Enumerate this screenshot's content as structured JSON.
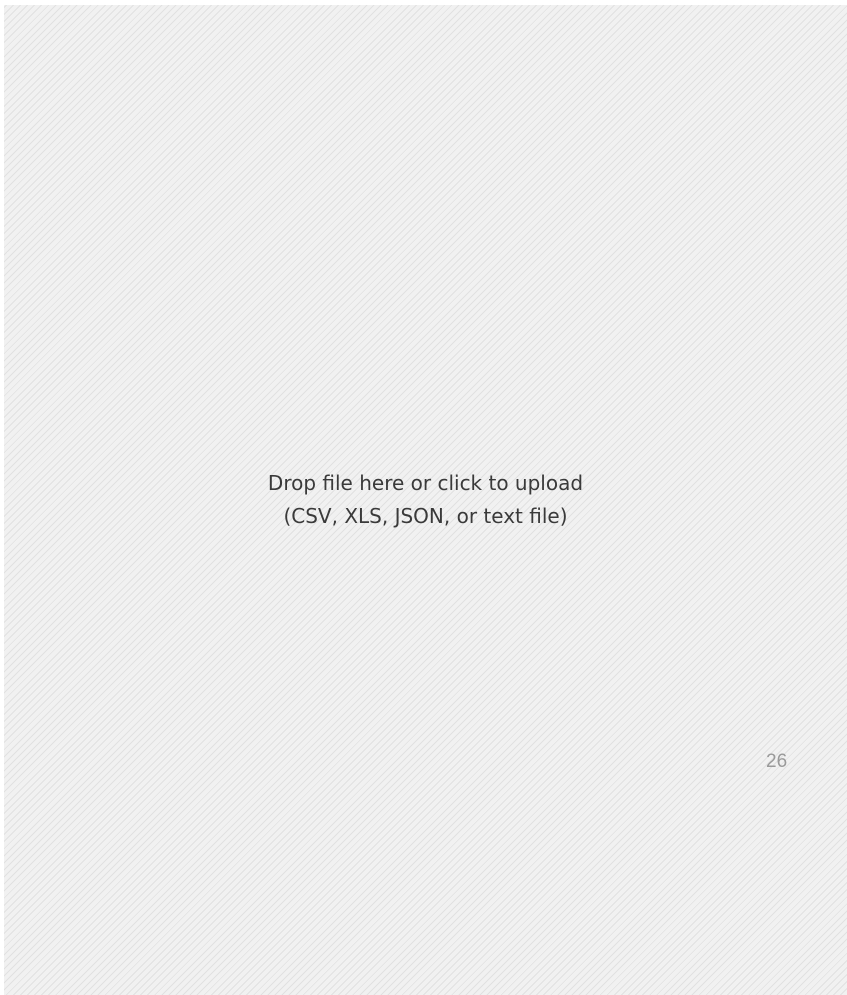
{
  "dropzone": {
    "line1": "Drop file here or click to upload",
    "line2": "(CSV, XLS, JSON, or text file)"
  },
  "page_number": "26"
}
